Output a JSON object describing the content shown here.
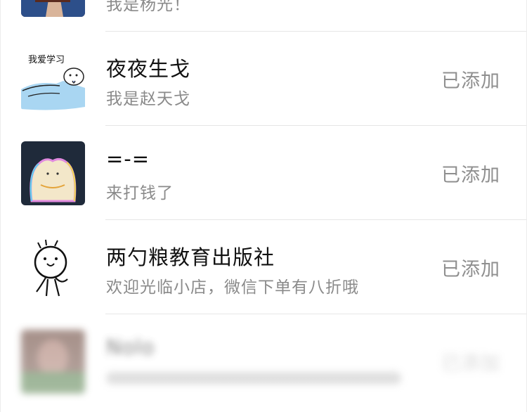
{
  "contacts": [
    {
      "name": "",
      "subtitle": "我是杨光！",
      "status": "",
      "avatar_icon": "brown-photo-avatar-icon"
    },
    {
      "name": "夜夜生戈",
      "subtitle": "我是赵天戈",
      "status": "已添加",
      "avatar_icon": "study-cartoon-avatar-icon",
      "avatar_caption": "我爱学习"
    },
    {
      "name": "=-=",
      "subtitle": "来打钱了",
      "status": "已添加",
      "avatar_icon": "fluffy-cat-avatar-icon"
    },
    {
      "name": "两勺粮教育出版社",
      "subtitle": "欢迎光临小店，微信下单有八折哦",
      "status": "已添加",
      "avatar_icon": "doodle-character-avatar-icon"
    },
    {
      "name": "Nolo",
      "subtitle": "",
      "status": "已添加",
      "avatar_icon": "blurred-photo-avatar-icon"
    }
  ],
  "colors": {
    "name_text": "#111111",
    "subtitle_text": "#8a8a8a",
    "status_text": "#8f8f8f",
    "divider": "#e6e6e6",
    "background": "#ffffff"
  }
}
